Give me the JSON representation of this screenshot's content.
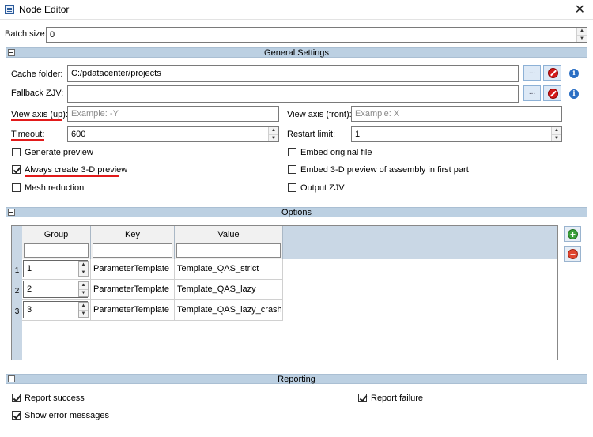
{
  "window": {
    "title": "Node Editor",
    "close_glyph": "✕"
  },
  "batch": {
    "label": "Batch size:",
    "value": "0"
  },
  "general": {
    "title": "General Settings",
    "cache_folder": {
      "label": "Cache folder:",
      "value": "C:/pdatacenter/projects"
    },
    "fallback_zjv": {
      "label": "Fallback ZJV:",
      "value": ""
    },
    "view_axis_up": {
      "label": "View axis (up):",
      "placeholder": "Example: -Y"
    },
    "view_axis_front": {
      "label": "View axis (front):",
      "placeholder": "Example: X"
    },
    "timeout": {
      "label": "Timeout:",
      "value": "600"
    },
    "restart_limit": {
      "label": "Restart limit:",
      "value": "1"
    },
    "dots_label": "...",
    "checkboxes": {
      "generate_preview": {
        "label": "Generate preview",
        "checked": false
      },
      "embed_original": {
        "label": "Embed original file",
        "checked": false
      },
      "always_3d": {
        "label": "Always create 3-D preview",
        "checked": true
      },
      "embed_3d_assembly": {
        "label": "Embed 3-D preview of assembly in first part",
        "checked": false
      },
      "mesh_reduction": {
        "label": "Mesh reduction",
        "checked": false
      },
      "output_zjv": {
        "label": "Output ZJV",
        "checked": false
      }
    }
  },
  "options": {
    "title": "Options",
    "columns": [
      "Group",
      "Key",
      "Value"
    ],
    "rows": [
      {
        "num": "1",
        "group": "1",
        "key": "ParameterTemplate",
        "value": "Template_QAS_strict"
      },
      {
        "num": "2",
        "group": "2",
        "key": "ParameterTemplate",
        "value": "Template_QAS_lazy"
      },
      {
        "num": "3",
        "group": "3",
        "key": "ParameterTemplate",
        "value": "Template_QAS_lazy_crash"
      }
    ]
  },
  "reporting": {
    "title": "Reporting",
    "report_success": {
      "label": "Report success",
      "checked": true
    },
    "report_failure": {
      "label": "Report failure",
      "checked": true
    },
    "show_errors": {
      "label": "Show error messages",
      "checked": true
    }
  },
  "colors": {
    "section_header": "#bcd0e2",
    "annotation_red": "#e21a1a",
    "button_blue": "#dde9f6"
  }
}
